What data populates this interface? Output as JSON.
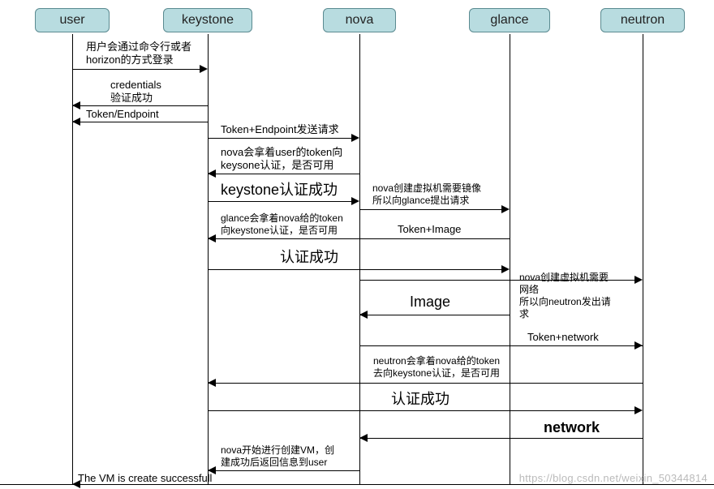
{
  "participants": {
    "user": "user",
    "keystone": "keystone",
    "nova": "nova",
    "glance": "glance",
    "neutron": "neutron"
  },
  "messages": {
    "m1": "用户会通过命令行或者\nhorizon的方式登录",
    "m2": "credentials\n验证成功",
    "m3": "Token/Endpoint",
    "m4": "Token+Endpoint发送请求",
    "m5": "nova会拿着user的token向\nkeysone认证，是否可用",
    "m6": "keystone认证成功",
    "m7": "nova创建虚拟机需要镜像\n所以向glance提出请求",
    "m8": "glance会拿着nova给的token\n向keystone认证，是否可用",
    "m9": "Token+Image",
    "m10": "认证成功",
    "m11": "nova创建虚拟机需要\n网络\n所以向neutron发出请\n求",
    "m12": "Image",
    "m13": "Token+network",
    "m14": "neutron会拿着nova给的token\n去向keystone认证，是否可用",
    "m15": "认证成功",
    "m16": "network",
    "m17": "nova开始进行创建VM，创\n建成功后返回信息到user",
    "m18": "The VM is create successfull"
  },
  "watermark": "https://blog.csdn.net/weixin_50344814",
  "chart_data": {
    "type": "sequence-diagram",
    "participants": [
      "user",
      "keystone",
      "nova",
      "glance",
      "neutron"
    ],
    "interactions": [
      {
        "from": "user",
        "to": "keystone",
        "label": "用户会通过命令行或者 horizon的方式登录"
      },
      {
        "from": "keystone",
        "to": "user",
        "label": "credentials 验证成功"
      },
      {
        "from": "keystone",
        "to": "user",
        "label": "Token/Endpoint"
      },
      {
        "from": "keystone",
        "to": "nova",
        "label": "Token+Endpoint发送请求"
      },
      {
        "from": "nova",
        "to": "keystone",
        "label": "nova会拿着user的token向keysone认证，是否可用"
      },
      {
        "from": "keystone",
        "to": "nova",
        "label": "keystone认证成功"
      },
      {
        "from": "nova",
        "to": "glance",
        "label": "nova创建虚拟机需要镜像 所以向glance提出请求"
      },
      {
        "from": "glance",
        "to": "keystone",
        "label": "glance会拿着nova给的token 向keystone认证，是否可用"
      },
      {
        "from": "glance",
        "to": "nova",
        "label": "Token+Image"
      },
      {
        "from": "keystone",
        "to": "glance",
        "label": "认证成功"
      },
      {
        "from": "glance",
        "to": "nova",
        "label": "Image"
      },
      {
        "from": "nova",
        "to": "neutron",
        "label": "nova创建虚拟机需要网络 所以向neutron发出请求"
      },
      {
        "from": "neutron",
        "to": "nova",
        "label": "Token+network"
      },
      {
        "from": "neutron",
        "to": "keystone",
        "label": "neutron会拿着nova给的token 去向keystone认证，是否可用"
      },
      {
        "from": "keystone",
        "to": "neutron",
        "label": "认证成功"
      },
      {
        "from": "neutron",
        "to": "nova",
        "label": "network"
      },
      {
        "from": "nova",
        "to": "keystone",
        "label": "nova开始进行创建VM，创建成功后返回信息到user"
      },
      {
        "from": "keystone",
        "to": "user",
        "label": "The VM is create successfull"
      }
    ]
  }
}
